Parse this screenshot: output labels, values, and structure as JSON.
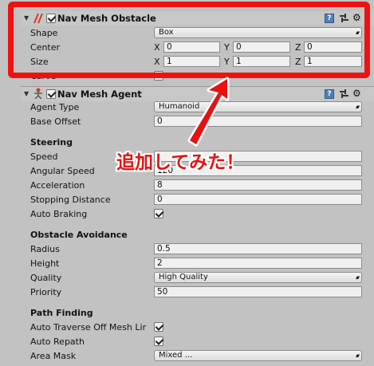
{
  "nav_mesh_obstacle": {
    "title": "Nav Mesh Obstacle",
    "enabled": true,
    "shape_label": "Shape",
    "shape_value": "Box",
    "center_label": "Center",
    "center": {
      "x_label": "X",
      "x": "0",
      "y_label": "Y",
      "y": "0",
      "z_label": "Z",
      "z": "0"
    },
    "size_label": "Size",
    "size": {
      "x_label": "X",
      "x": "1",
      "y_label": "Y",
      "y": "1",
      "z_label": "Z",
      "z": "1"
    },
    "carve_label": "Carve",
    "carve": false
  },
  "nav_mesh_agent": {
    "title": "Nav Mesh Agent",
    "enabled": true,
    "agent_type_label": "Agent Type",
    "agent_type_value": "Humanoid",
    "base_offset_label": "Base Offset",
    "base_offset": "0",
    "steering": {
      "heading": "Steering",
      "speed_label": "Speed",
      "angular_speed_label": "Angular Speed",
      "angular_speed": "120",
      "acceleration_label": "Acceleration",
      "acceleration": "8",
      "stopping_distance_label": "Stopping Distance",
      "stopping_distance": "0",
      "auto_braking_label": "Auto Braking",
      "auto_braking": true
    },
    "obstacle_avoidance": {
      "heading": "Obstacle Avoidance",
      "radius_label": "Radius",
      "radius": "0.5",
      "height_label": "Height",
      "height": "2",
      "quality_label": "Quality",
      "quality_value": "High Quality",
      "priority_label": "Priority",
      "priority": "50"
    },
    "path_finding": {
      "heading": "Path Finding",
      "auto_traverse_label": "Auto Traverse Off Mesh Lir",
      "auto_traverse": true,
      "auto_repath_label": "Auto Repath",
      "auto_repath": true,
      "area_mask_label": "Area Mask",
      "area_mask_value": "Mixed ..."
    }
  },
  "annotation": {
    "text": "追加してみた！",
    "color": "#e81111"
  },
  "icons": {
    "help": "?",
    "gear": "⚙",
    "dropdown_arrow": "▲▼"
  },
  "colors": {
    "inspector_bg": "#c2c2c2",
    "highlight": "#ee1212",
    "field_bg": "#f0f0f0"
  }
}
